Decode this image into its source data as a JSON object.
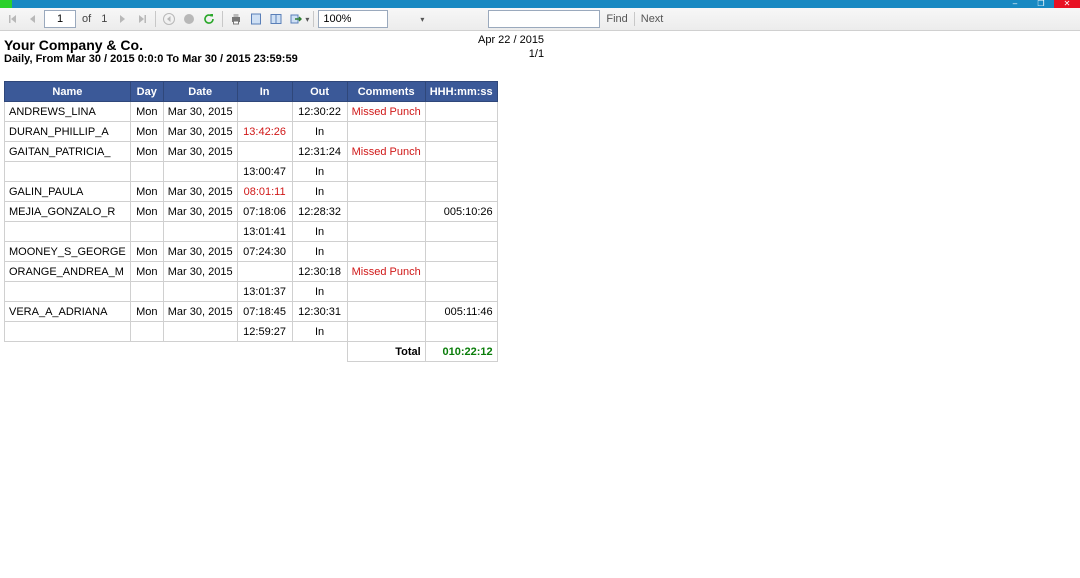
{
  "window": {
    "min": "–",
    "max": "❐",
    "close": "✕"
  },
  "toolbar": {
    "page_current": "1",
    "of_label": "of",
    "page_total": "1",
    "zoom": "100%",
    "find_label": "Find",
    "next_label": "Next"
  },
  "report": {
    "company": "Your Company & Co.",
    "subheader": "Daily,  From Mar 30 / 2015 0:0:0 To Mar 30 / 2015 23:59:59",
    "run_date": "Apr 22 / 2015",
    "page_indicator": "1/1",
    "headers": {
      "name": "Name",
      "day": "Day",
      "date": "Date",
      "in": "In",
      "out": "Out",
      "comments": "Comments",
      "hours": "HHH:mm:ss"
    },
    "rows": [
      {
        "name": "ANDREWS_LINA",
        "day": "Mon",
        "date": "Mar 30, 2015",
        "in": "",
        "in_red": false,
        "out": "12:30:22",
        "out_txt": "12:30:22",
        "cmt": "Missed Punch",
        "cmt_red": true,
        "hrs": ""
      },
      {
        "name": "DURAN_PHILLIP_A",
        "day": "Mon",
        "date": "Mar 30, 2015",
        "in": "13:42:26",
        "in_red": true,
        "out": "",
        "out_txt": "In",
        "cmt": "",
        "cmt_red": false,
        "hrs": ""
      },
      {
        "name": "GAITAN_PATRICIA_",
        "day": "Mon",
        "date": "Mar 30, 2015",
        "in": "",
        "in_red": false,
        "out": "12:31:24",
        "out_txt": "12:31:24",
        "cmt": "Missed Punch",
        "cmt_red": true,
        "hrs": ""
      },
      {
        "name": "",
        "day": "",
        "date": "",
        "in": "13:00:47",
        "in_red": false,
        "out": "",
        "out_txt": "In",
        "cmt": "",
        "cmt_red": false,
        "hrs": ""
      },
      {
        "name": "GALIN_PAULA",
        "day": "Mon",
        "date": "Mar 30, 2015",
        "in": "08:01:11",
        "in_red": true,
        "out": "",
        "out_txt": "In",
        "cmt": "",
        "cmt_red": false,
        "hrs": ""
      },
      {
        "name": "MEJIA_GONZALO_R",
        "day": "Mon",
        "date": "Mar 30, 2015",
        "in": "07:18:06",
        "in_red": false,
        "out": "12:28:32",
        "out_txt": "12:28:32",
        "cmt": "",
        "cmt_red": false,
        "hrs": "005:10:26"
      },
      {
        "name": "",
        "day": "",
        "date": "",
        "in": "13:01:41",
        "in_red": false,
        "out": "",
        "out_txt": "In",
        "cmt": "",
        "cmt_red": false,
        "hrs": ""
      },
      {
        "name": "MOONEY_S_GEORGE",
        "day": "Mon",
        "date": "Mar 30, 2015",
        "in": "07:24:30",
        "in_red": false,
        "out": "",
        "out_txt": "In",
        "cmt": "",
        "cmt_red": false,
        "hrs": ""
      },
      {
        "name": "ORANGE_ANDREA_M",
        "day": "Mon",
        "date": "Mar 30, 2015",
        "in": "",
        "in_red": false,
        "out": "12:30:18",
        "out_txt": "12:30:18",
        "cmt": "Missed Punch",
        "cmt_red": true,
        "hrs": ""
      },
      {
        "name": "",
        "day": "",
        "date": "",
        "in": "13:01:37",
        "in_red": false,
        "out": "",
        "out_txt": "In",
        "cmt": "",
        "cmt_red": false,
        "hrs": ""
      },
      {
        "name": "VERA_A_ADRIANA",
        "day": "Mon",
        "date": "Mar 30, 2015",
        "in": "07:18:45",
        "in_red": false,
        "out": "12:30:31",
        "out_txt": "12:30:31",
        "cmt": "",
        "cmt_red": false,
        "hrs": "005:11:46"
      },
      {
        "name": "",
        "day": "",
        "date": "",
        "in": "12:59:27",
        "in_red": false,
        "out": "",
        "out_txt": "In",
        "cmt": "",
        "cmt_red": false,
        "hrs": ""
      }
    ],
    "total_label": "Total",
    "total_value": "010:22:12"
  }
}
